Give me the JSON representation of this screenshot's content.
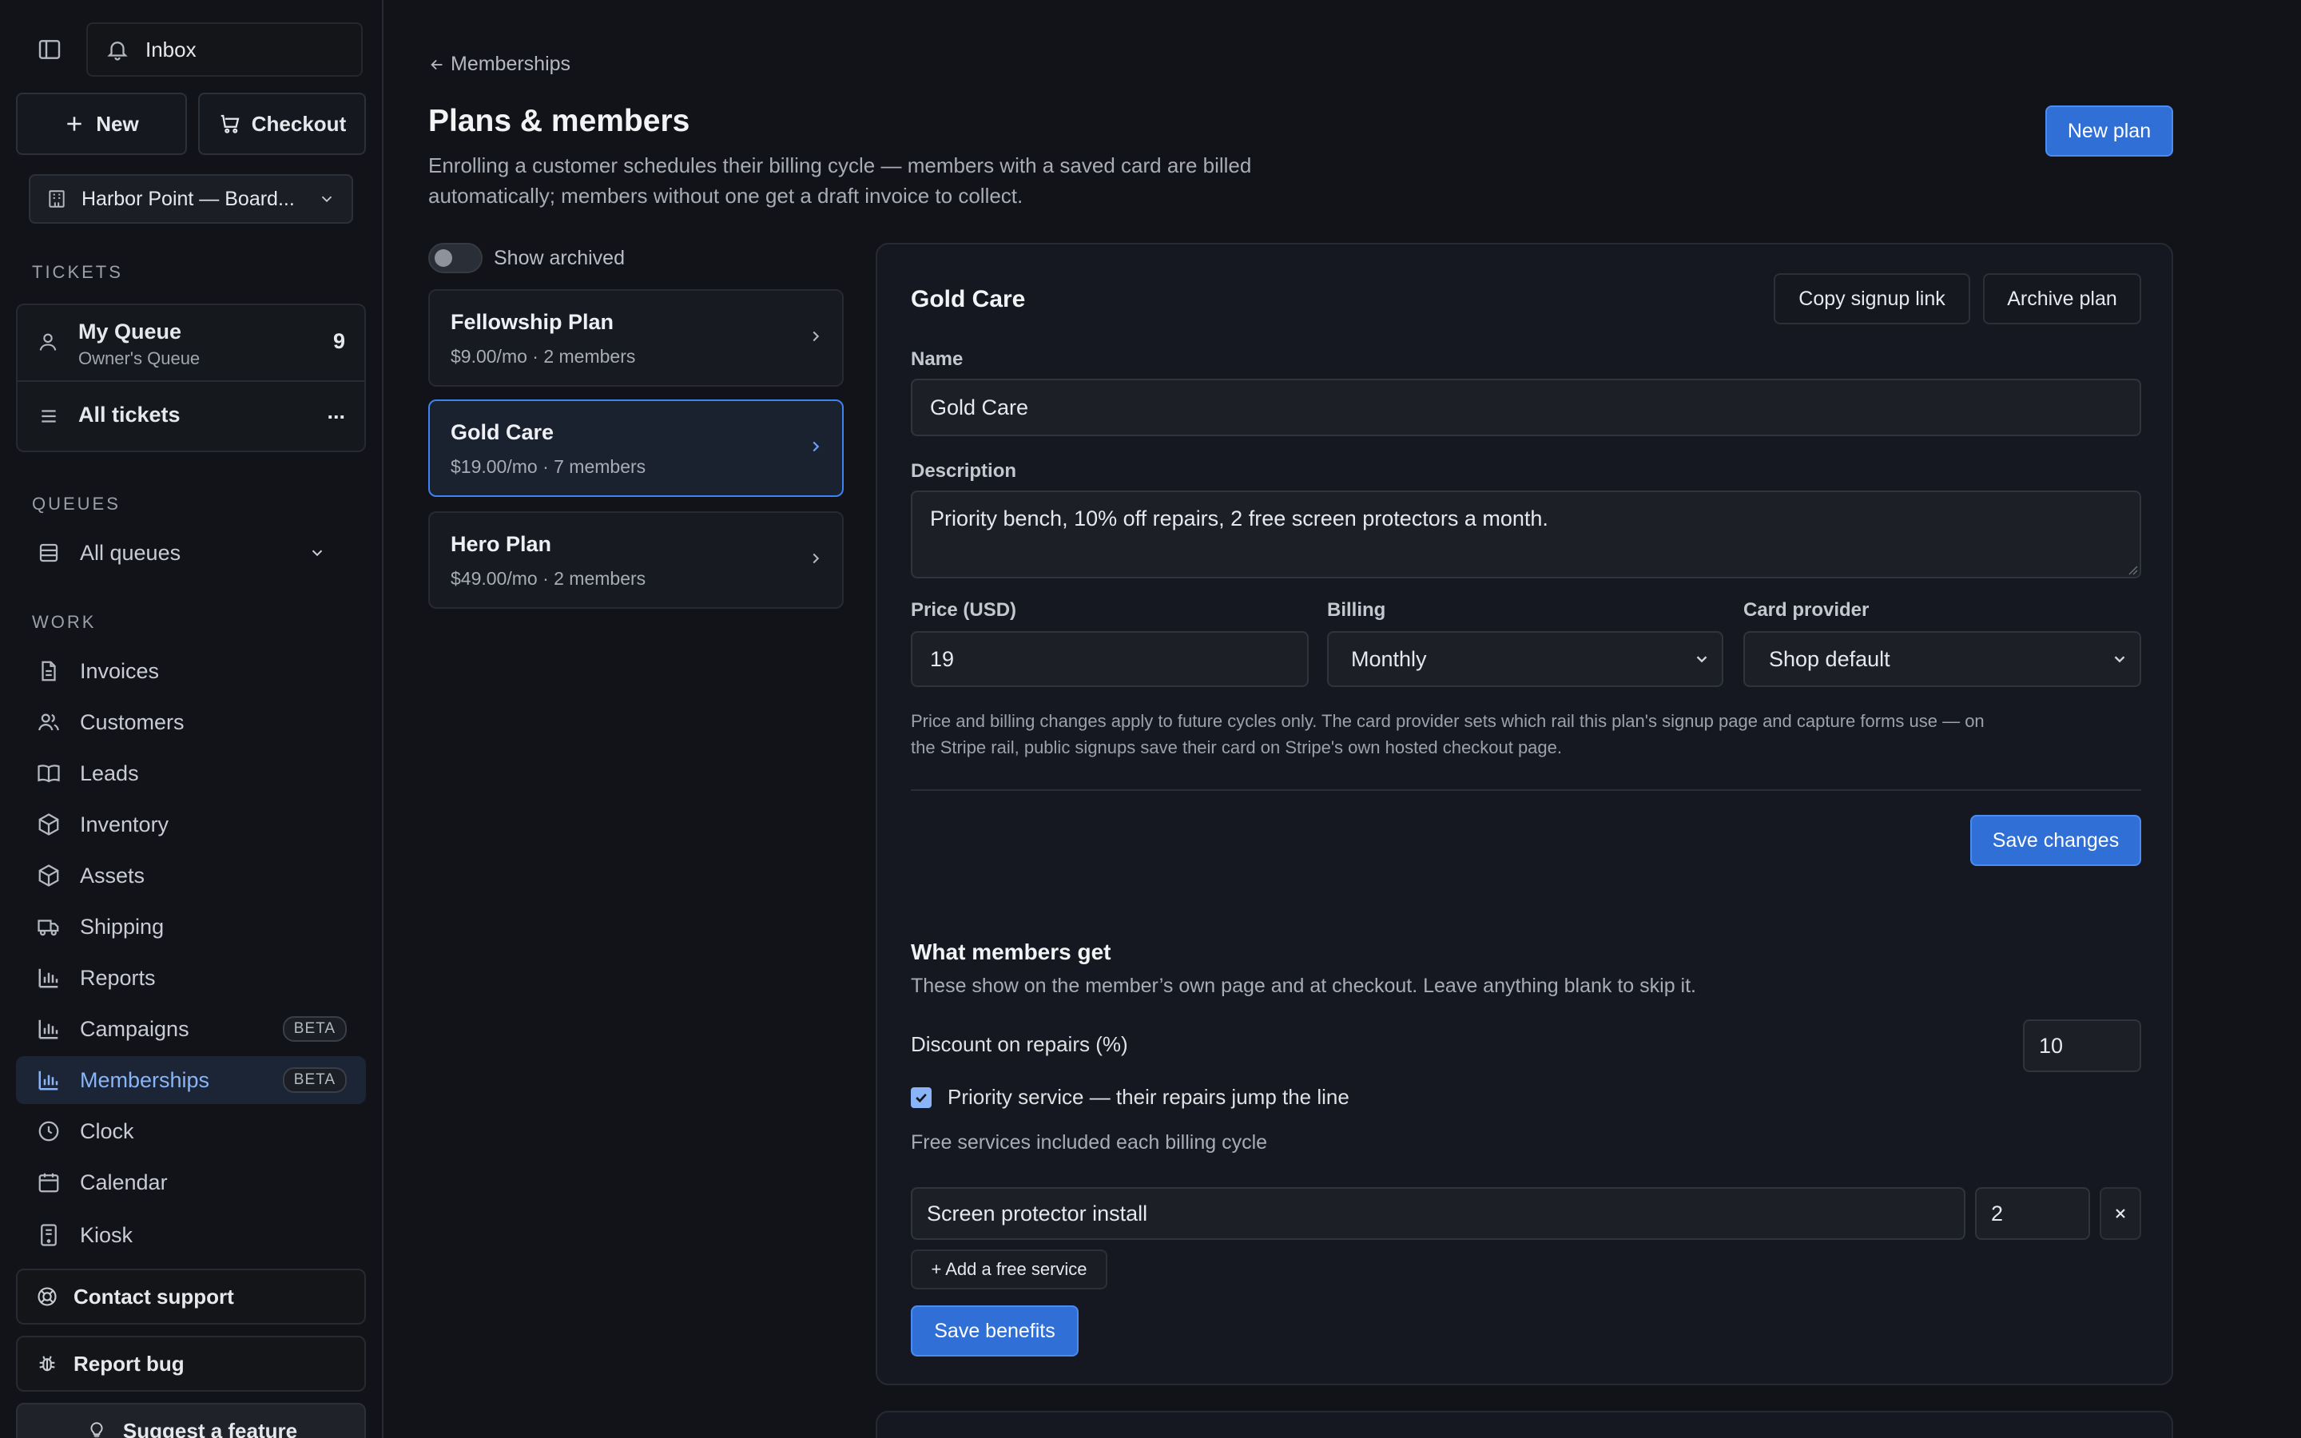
{
  "sidebar": {
    "inbox_label": "Inbox",
    "new_label": "New",
    "checkout_label": "Checkout",
    "location": "Harbor Point — Board...",
    "tickets_section": "TICKETS",
    "my_queue": {
      "title": "My Queue",
      "subtitle": "Owner's Queue",
      "count": "9"
    },
    "all_tickets": {
      "label": "All tickets",
      "more": "..."
    },
    "queues_section": "QUEUES",
    "all_queues_label": "All queues",
    "work_section": "WORK",
    "items": [
      {
        "label": "Invoices",
        "icon": "file-icon"
      },
      {
        "label": "Customers",
        "icon": "users-icon"
      },
      {
        "label": "Leads",
        "icon": "book-icon"
      },
      {
        "label": "Inventory",
        "icon": "box-icon"
      },
      {
        "label": "Assets",
        "icon": "box-icon"
      },
      {
        "label": "Shipping",
        "icon": "truck-icon"
      },
      {
        "label": "Reports",
        "icon": "bar-chart-icon"
      },
      {
        "label": "Campaigns",
        "icon": "bar-chart-icon",
        "badge": "BETA"
      },
      {
        "label": "Memberships",
        "icon": "bar-chart-icon",
        "badge": "BETA",
        "active": true
      },
      {
        "label": "Clock",
        "icon": "clock-icon"
      },
      {
        "label": "Calendar",
        "icon": "calendar-icon"
      },
      {
        "label": "Kiosk",
        "icon": "tablet-icon"
      }
    ],
    "contact_support": "Contact support",
    "report_bug": "Report bug",
    "suggest_feature": "Suggest a feature"
  },
  "header": {
    "back_link": "Memberships",
    "title": "Plans & members",
    "description_line1": "Enrolling a customer schedules their billing cycle — members with a saved card are billed",
    "description_line2": "automatically; members without one get a draft invoice to collect.",
    "new_plan_label": "New plan"
  },
  "plans": {
    "show_archived_label": "Show archived",
    "show_archived_on": false,
    "list": [
      {
        "name": "Fellowship Plan",
        "meta": "$9.00/mo · 2 members"
      },
      {
        "name": "Gold Care",
        "meta": "$19.00/mo · 7 members",
        "selected": true
      },
      {
        "name": "Hero Plan",
        "meta": "$49.00/mo · 2 members"
      }
    ]
  },
  "detail": {
    "title": "Gold Care",
    "copy_link_label": "Copy signup link",
    "archive_label": "Archive plan",
    "name_label": "Name",
    "name_value": "Gold Care",
    "description_label": "Description",
    "description_value": "Priority bench, 10% off repairs, 2 free screen protectors a month.",
    "price_label": "Price (USD)",
    "price_value": "19",
    "billing_label": "Billing",
    "billing_value": "Monthly",
    "provider_label": "Card provider",
    "provider_value": "Shop default",
    "help_line1": "Price and billing changes apply to future cycles only. The card provider sets which rail this plan's signup page and capture forms use — on",
    "help_line2": "the Stripe rail, public signups save their card on Stripe's own hosted checkout page.",
    "save_changes_label": "Save changes"
  },
  "benefits": {
    "title": "What members get",
    "subtitle": "These show on the member’s own page and at checkout. Leave anything blank to skip it.",
    "discount_label": "Discount on repairs (%)",
    "discount_value": "10",
    "priority_label": "Priority service — their repairs jump the line",
    "priority_checked": true,
    "free_services_label": "Free services included each billing cycle",
    "services": [
      {
        "name": "Screen protector install",
        "qty": "2"
      }
    ],
    "add_service_label": "+ Add a free service",
    "save_benefits_label": "Save benefits"
  },
  "colors": {
    "background": "#111318",
    "accent": "#2f6fd6",
    "active_nav": "#8ab4f8"
  }
}
